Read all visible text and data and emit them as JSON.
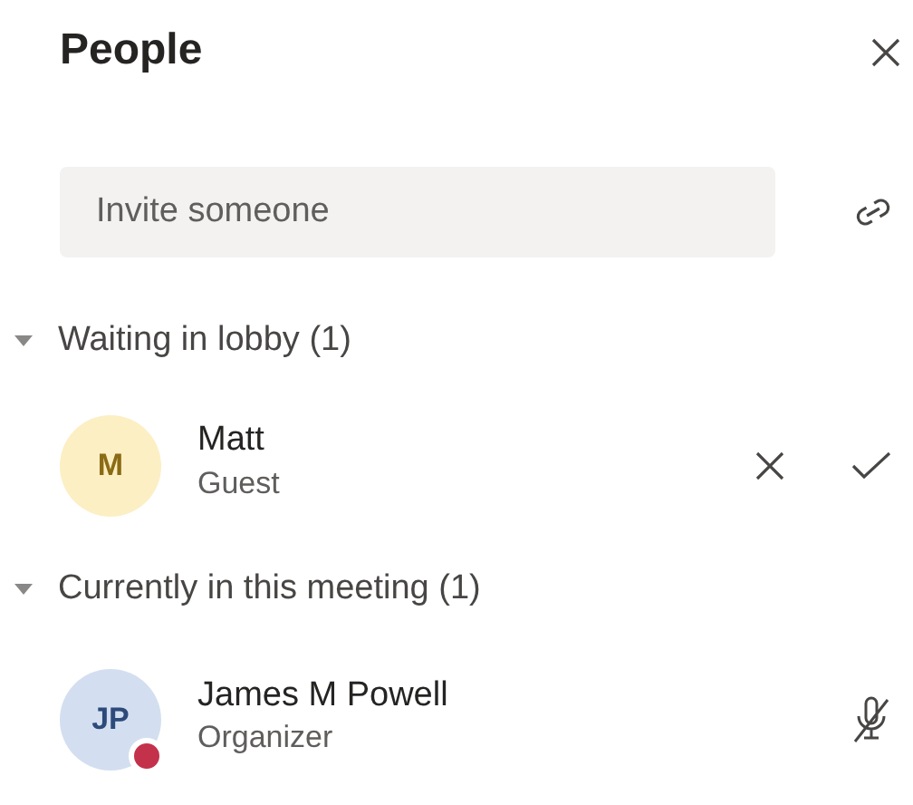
{
  "panel": {
    "title": "People"
  },
  "invite": {
    "placeholder": "Invite someone"
  },
  "sections": [
    {
      "title": "Waiting in lobby (1)",
      "expanded": true,
      "people": [
        {
          "kind": "lobby",
          "initials": "M",
          "name": "Matt",
          "role": "Guest"
        }
      ]
    },
    {
      "title": "Currently in this meeting (1)",
      "expanded": true,
      "people": [
        {
          "kind": "member",
          "initials": "JP",
          "name": "James M Powell",
          "role": "Organizer",
          "color": "#c4314b",
          "muted": true
        }
      ]
    }
  ]
}
